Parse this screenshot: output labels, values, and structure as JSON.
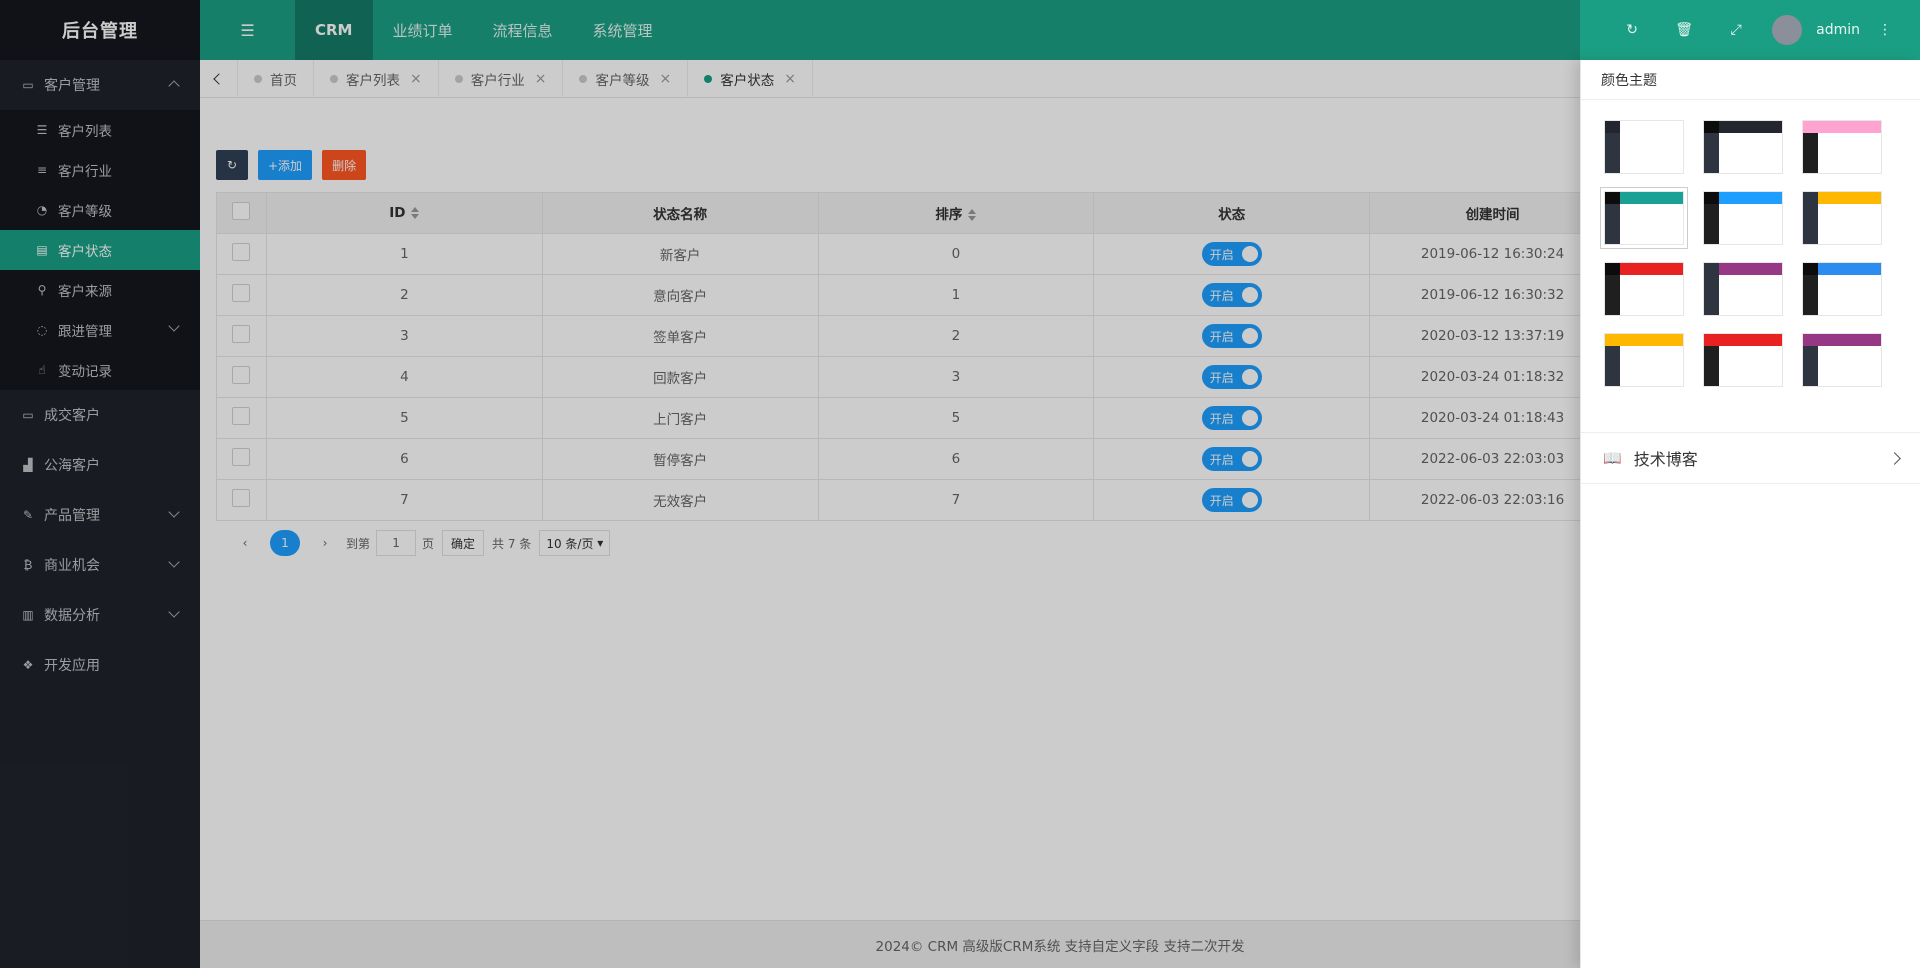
{
  "sidebar": {
    "logo": "后台管理",
    "groups": [
      {
        "label": "客户管理",
        "icon": "id-card-icon"
      },
      {
        "label": "成交客户",
        "icon": "card-icon"
      },
      {
        "label": "公海客户",
        "icon": "chart-icon"
      },
      {
        "label": "产品管理",
        "icon": "brush-icon"
      },
      {
        "label": "商业机会",
        "icon": "bitcoin-icon"
      },
      {
        "label": "数据分析",
        "icon": "bar-chart-icon"
      },
      {
        "label": "开发应用",
        "icon": "cubes-icon"
      }
    ],
    "sub_items": [
      {
        "label": "客户列表",
        "icon": "list-icon"
      },
      {
        "label": "客户行业",
        "icon": "align-icon"
      },
      {
        "label": "客户等级",
        "icon": "dashboard-icon"
      },
      {
        "label": "客户状态",
        "icon": "newspaper-icon"
      },
      {
        "label": "客户来源",
        "icon": "walk-icon"
      },
      {
        "label": "跟进管理",
        "icon": "comments-icon"
      },
      {
        "label": "变动记录",
        "icon": "hand-icon"
      }
    ]
  },
  "header": {
    "nav": [
      "CRM",
      "业绩订单",
      "流程信息",
      "系统管理"
    ],
    "user": "admin"
  },
  "tabs": [
    {
      "label": "首页"
    },
    {
      "label": "客户列表"
    },
    {
      "label": "客户行业"
    },
    {
      "label": "客户等级"
    },
    {
      "label": "客户状态"
    }
  ],
  "toolbar": {
    "add_label": "+添加",
    "delete_label": "删除"
  },
  "table": {
    "columns": [
      "ID",
      "状态名称",
      "排序",
      "状态",
      "创建时间"
    ],
    "rows": [
      {
        "id": "1",
        "name": "新客户",
        "sort": "0",
        "status": "开启",
        "time": "2019-06-12 16:30:24"
      },
      {
        "id": "2",
        "name": "意向客户",
        "sort": "1",
        "status": "开启",
        "time": "2019-06-12 16:30:32"
      },
      {
        "id": "3",
        "name": "签单客户",
        "sort": "2",
        "status": "开启",
        "time": "2020-03-12 13:37:19"
      },
      {
        "id": "4",
        "name": "回款客户",
        "sort": "3",
        "status": "开启",
        "time": "2020-03-24 01:18:32"
      },
      {
        "id": "5",
        "name": "上门客户",
        "sort": "5",
        "status": "开启",
        "time": "2020-03-24 01:18:43"
      },
      {
        "id": "6",
        "name": "暂停客户",
        "sort": "6",
        "status": "开启",
        "time": "2022-06-03 22:03:03"
      },
      {
        "id": "7",
        "name": "无效客户",
        "sort": "7",
        "status": "开启",
        "time": "2022-06-03 22:03:16"
      }
    ]
  },
  "pager": {
    "current": "1",
    "goto_label": "到第",
    "goto_value": "1",
    "page_label": "页",
    "confirm": "确定",
    "total": "共 7 条",
    "size": "10 条/页"
  },
  "footer": "2024© CRM 高级版CRM系统 支持自定义字段 支持二次开发",
  "panel": {
    "title": "颜色主题",
    "link": "技术博客",
    "themes": [
      {
        "logo": "#23262e",
        "top": "#ffffff",
        "side": "#2e3541"
      },
      {
        "logo": "#0c0c0c",
        "top": "#23262e",
        "side": "#2e3541"
      },
      {
        "logo": "#ffa4d1",
        "top": "#ffa4d1",
        "side": "#1f1f1f"
      },
      {
        "logo": "#0c0c0c",
        "top": "#1aa094",
        "side": "#2e3541"
      },
      {
        "logo": "#0c0c0c",
        "top": "#1e9fff",
        "side": "#1f1f1f"
      },
      {
        "logo": "#2e3541",
        "top": "#ffb800",
        "side": "#2e3541"
      },
      {
        "logo": "#0c0c0c",
        "top": "#e82121",
        "side": "#1f1f1f"
      },
      {
        "logo": "#2e3541",
        "top": "#963885",
        "side": "#2e3541"
      },
      {
        "logo": "#0c0c0c",
        "top": "#2d8cf0",
        "side": "#1f1f1f"
      },
      {
        "logo": "#ffb800",
        "top": "#ffb800",
        "side": "#2e3541"
      },
      {
        "logo": "#e82121",
        "top": "#e82121",
        "side": "#1f1f1f"
      },
      {
        "logo": "#963885",
        "top": "#963885",
        "side": "#2e3541"
      }
    ]
  }
}
